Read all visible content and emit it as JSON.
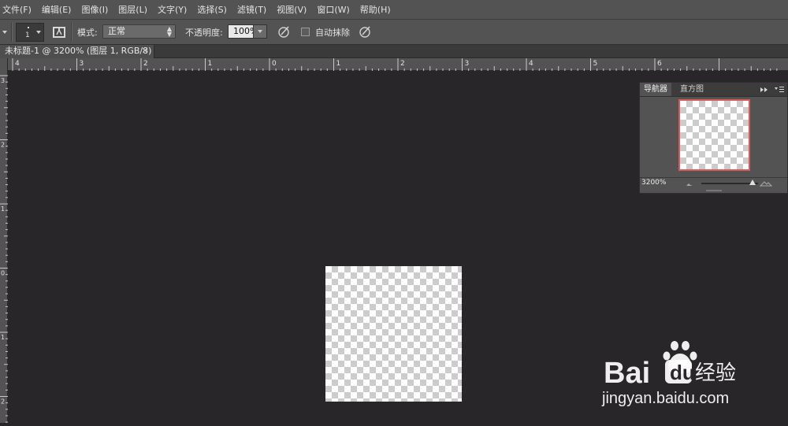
{
  "menu": [
    "文件(F)",
    "编辑(E)",
    "图像(I)",
    "图层(L)",
    "文字(Y)",
    "选择(S)",
    "滤镜(T)",
    "视图(V)",
    "窗口(W)",
    "帮助(H)"
  ],
  "options": {
    "brush_size": "1",
    "mode_label": "模式:",
    "mode_value": "正常",
    "opacity_label": "不透明度:",
    "opacity_value": "100%",
    "auto_erase_label": "自动抹除"
  },
  "document": {
    "tab_title": "未标题-1 @ 3200% (图层 1, RGB/8)",
    "close_glyph": "×"
  },
  "rulers": {
    "h_labels": [
      "4",
      "3",
      "2",
      "1",
      "0",
      "1",
      "2",
      "3",
      "4",
      "5",
      "6"
    ],
    "v_labels": [
      "3",
      "2",
      "1",
      "0",
      "1",
      "2"
    ]
  },
  "navigator": {
    "tabs": [
      "导航器",
      "直方图"
    ],
    "zoom": "3200%"
  },
  "watermark": {
    "brand": "Bai",
    "brand_suffix": "经验",
    "url": "jingyan.baidu.com"
  },
  "colors": {
    "bg_canvas": "#282628",
    "panel": "#535353",
    "nav_frame": "#d95a5a"
  }
}
